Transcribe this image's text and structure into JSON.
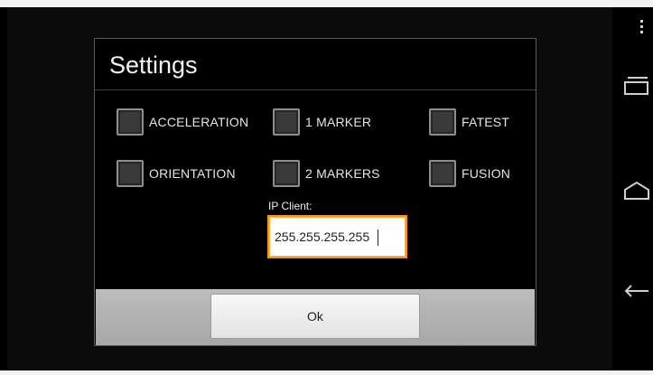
{
  "dialog": {
    "title": "Settings",
    "options": [
      {
        "label": "ACCELERATION",
        "checked": false
      },
      {
        "label": "1 MARKER",
        "checked": false
      },
      {
        "label": "FATEST",
        "checked": false
      },
      {
        "label": "ORIENTATION",
        "checked": false
      },
      {
        "label": "2 MARKERS",
        "checked": false
      },
      {
        "label": "FUSION",
        "checked": false
      }
    ],
    "ip_client": {
      "label": "IP Client:",
      "value": "255.255.255.255"
    },
    "ok_label": "Ok"
  },
  "navbar": {
    "icons": [
      "overflow-menu-icon",
      "recent-apps-icon",
      "home-icon",
      "back-icon"
    ]
  },
  "colors": {
    "focus_border": "#f7941d",
    "dialog_background": "#000000",
    "button_bar": "#b3b3b3"
  }
}
